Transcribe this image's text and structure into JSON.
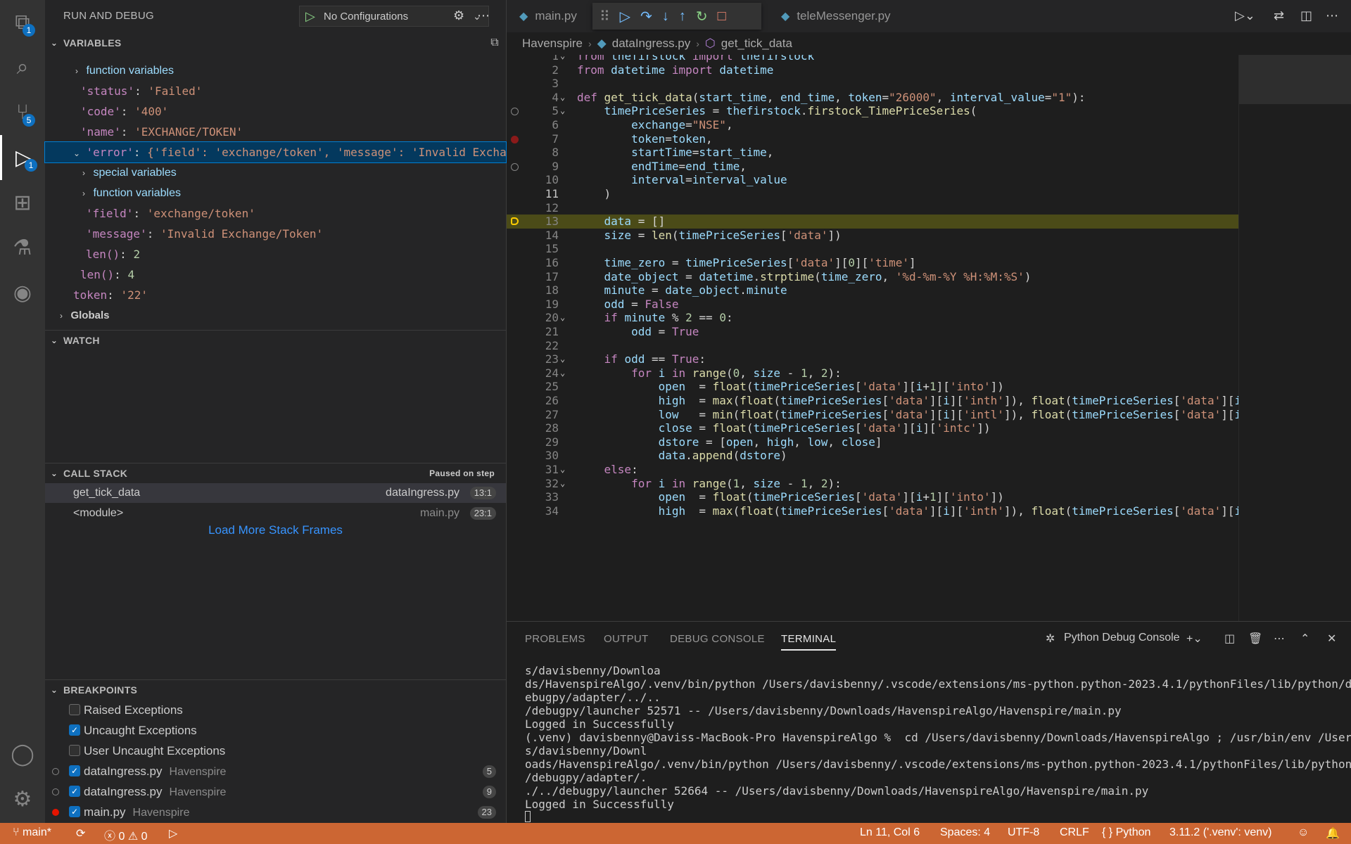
{
  "activity_bar": {
    "items": [
      {
        "icon": "files-icon",
        "badge": "1"
      },
      {
        "icon": "search-icon",
        "badge": ""
      },
      {
        "icon": "source-control-icon",
        "badge": "5"
      },
      {
        "icon": "run-debug-icon",
        "badge": "1"
      },
      {
        "icon": "extensions-icon",
        "badge": ""
      },
      {
        "icon": "testing-icon",
        "badge": ""
      },
      {
        "icon": "python-icon",
        "badge": ""
      }
    ]
  },
  "sidebar": {
    "title": "RUN AND DEBUG",
    "config_label": "No Configurations",
    "variables": {
      "header": "VARIABLES",
      "rows": [
        {
          "text": "function variables"
        },
        {
          "key": "'status'",
          "val": "'Failed'"
        },
        {
          "key": "'code'",
          "val": "'400'"
        },
        {
          "key": "'name'",
          "val": "'EXCHANGE/TOKEN'"
        },
        {
          "key": "'error'",
          "val": "{'field': 'exchange/token', 'message': 'Invalid Exchange…"
        },
        {
          "text": "special variables"
        },
        {
          "text": "function variables"
        },
        {
          "key": "'field'",
          "val": "'exchange/token'"
        },
        {
          "key": "'message'",
          "val": "'Invalid Exchange/Token'"
        },
        {
          "key": "len()",
          "val": "2"
        },
        {
          "key": "len()",
          "val": "4"
        },
        {
          "key": "token",
          "val": "'22'"
        },
        {
          "text": "Globals"
        }
      ]
    },
    "watch": {
      "header": "WATCH"
    },
    "call_stack": {
      "header": "CALL STACK",
      "status": "Paused on step",
      "frames": [
        {
          "name": "get_tick_data",
          "file": "dataIngress.py",
          "line": "13:1"
        },
        {
          "name": "<module>",
          "file": "main.py",
          "line": "23:1"
        }
      ],
      "load_more": "Load More Stack Frames"
    },
    "breakpoints": {
      "header": "BREAKPOINTS",
      "items": [
        {
          "label": "Raised Exceptions",
          "checked": false,
          "dir": "",
          "count": ""
        },
        {
          "label": "Uncaught Exceptions",
          "checked": true,
          "dir": "",
          "count": ""
        },
        {
          "label": "User Uncaught Exceptions",
          "checked": false,
          "dir": "",
          "count": ""
        },
        {
          "label": "dataIngress.py",
          "checked": true,
          "dir": "Havenspire",
          "count": "5"
        },
        {
          "label": "dataIngress.py",
          "checked": true,
          "dir": "Havenspire",
          "count": "9"
        },
        {
          "label": "main.py",
          "checked": true,
          "dir": "Havenspire",
          "count": "23"
        }
      ]
    }
  },
  "tabs": [
    {
      "label": "main.py"
    },
    {
      "label": "teleMessenger.py"
    }
  ],
  "breadcrumb": {
    "folder": "Havenspire",
    "file": "dataIngress.py",
    "symbol": "get_tick_data"
  },
  "editor": {
    "current_line": 11,
    "paused_line": 13,
    "lines": [
      "from thefirstock import thefirstock",
      "from datetime import datetime",
      "",
      "def get_tick_data(start_time, end_time, token=\"26000\", interval_value=\"1\"):",
      "    timePriceSeries = thefirstock.firstock_TimePriceSeries(",
      "        exchange=\"NSE\",",
      "        token=token,",
      "        startTime=start_time,",
      "        endTime=end_time,",
      "        interval=interval_value",
      "    )",
      "",
      "    data = []",
      "    size = len(timePriceSeries['data'])",
      "",
      "    time_zero = timePriceSeries['data'][0]['time']",
      "    date_object = datetime.strptime(time_zero, '%d-%m-%Y %H:%M:%S')",
      "    minute = date_object.minute",
      "    odd = False",
      "    if minute % 2 == 0:",
      "        odd = True",
      "",
      "    if odd == True:",
      "        for i in range(0, size - 1, 2):",
      "            open  = float(timePriceSeries['data'][i+1]['into'])",
      "            high  = max(float(timePriceSeries['data'][i]['inth']), float(timePriceSeries['data'][i+",
      "            low   = min(float(timePriceSeries['data'][i]['intl']), float(timePriceSeries['data'][i+",
      "            close = float(timePriceSeries['data'][i]['intc'])",
      "            dstore = [open, high, low, close]",
      "            data.append(dstore)",
      "    else:",
      "        for i in range(1, size - 1, 2):",
      "            open  = float(timePriceSeries['data'][i+1]['into'])",
      "            high  = max(float(timePriceSeries['data'][i]['inth']), float(timePriceSeries['data'][i+"
    ]
  },
  "panel": {
    "tabs": [
      "PROBLEMS",
      "OUTPUT",
      "DEBUG CONSOLE",
      "TERMINAL"
    ],
    "active_tab": "TERMINAL",
    "console_label": "Python Debug Console",
    "terminal_lines": [
      "s/davisbenny/Downloa",
      "ds/HavenspireAlgo/.venv/bin/python /Users/davisbenny/.vscode/extensions/ms-python.python-2023.4.1/pythonFiles/lib/python/d",
      "ebugpy/adapter/../..",
      "/debugpy/launcher 52571 -- /Users/davisbenny/Downloads/HavenspireAlgo/Havenspire/main.py",
      "Logged in Successfully",
      "(.venv) davisbenny@Daviss-MacBook-Pro HavenspireAlgo %  cd /Users/davisbenny/Downloads/HavenspireAlgo ; /usr/bin/env /User",
      "s/davisbenny/Downl",
      "oads/HavenspireAlgo/.venv/bin/python /Users/davisbenny/.vscode/extensions/ms-python.python-2023.4.1/pythonFiles/lib/python",
      "/debugpy/adapter/.",
      "./../debugpy/launcher 52664 -- /Users/davisbenny/Downloads/HavenspireAlgo/Havenspire/main.py",
      "Logged in Successfully"
    ]
  },
  "status_bar": {
    "branch": "main*",
    "errors": "0",
    "warnings": "0",
    "position": "Ln 11, Col 6",
    "spaces": "Spaces: 4",
    "encoding": "UTF-8",
    "eol": "CRLF",
    "language": "Python",
    "interpreter": "3.11.2 ('.venv': venv)",
    "color": "#cc6633"
  }
}
